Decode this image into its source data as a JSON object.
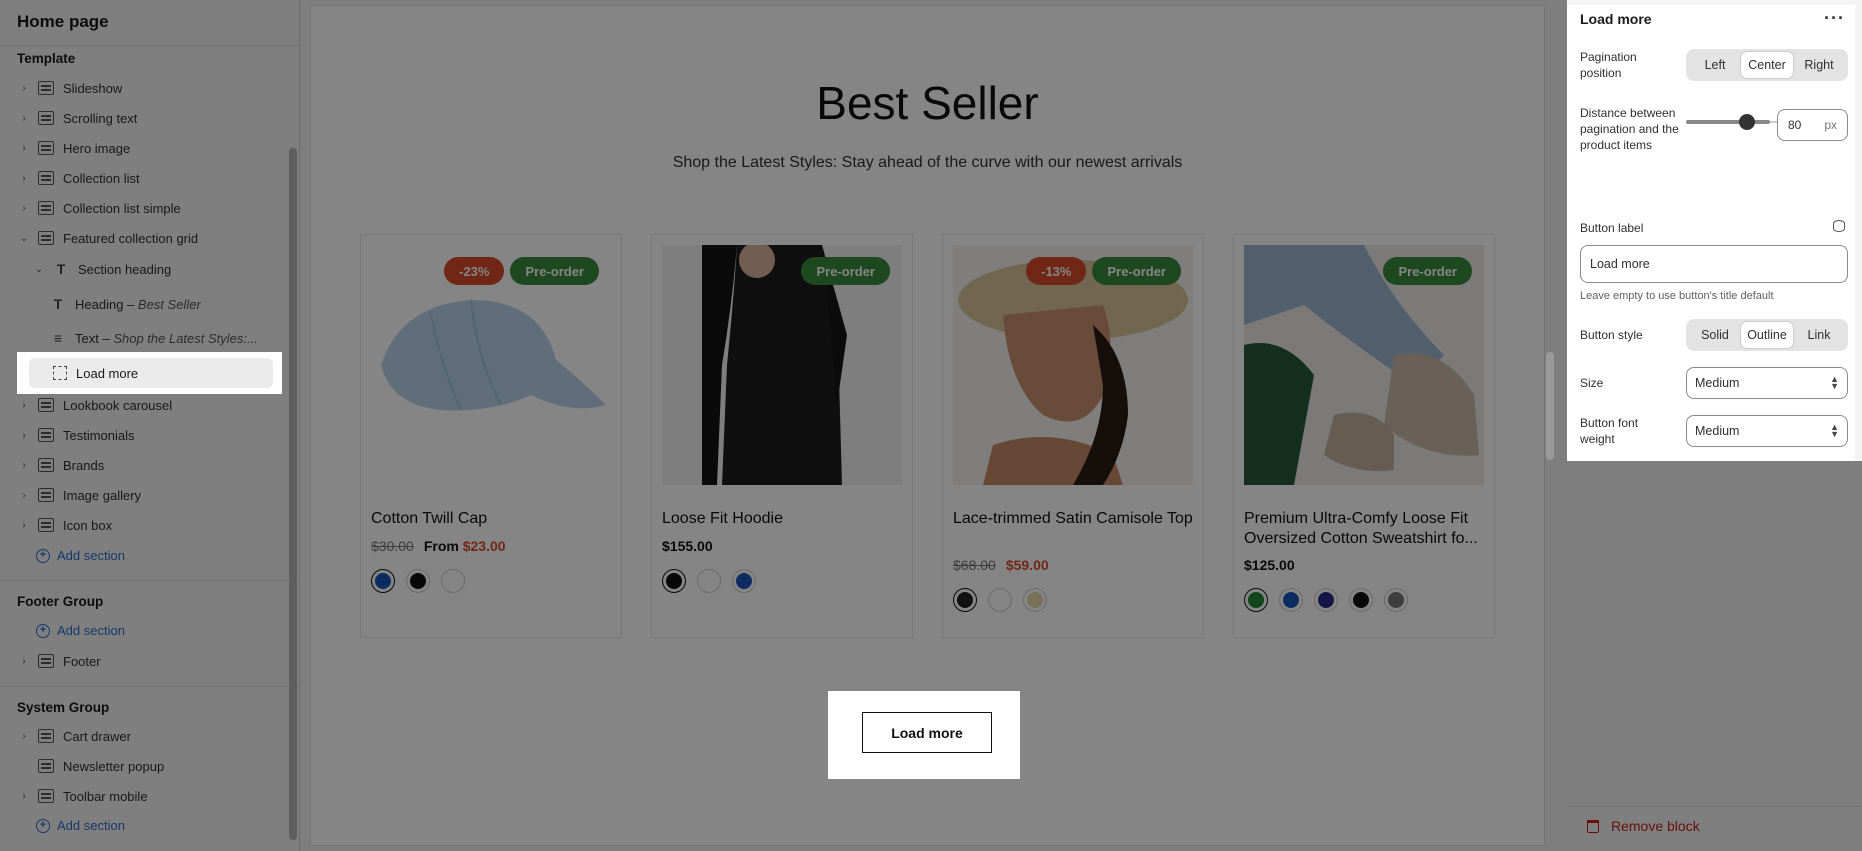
{
  "sidebar": {
    "title": "Home page",
    "template_label": "Template",
    "items": [
      {
        "label": "Slideshow"
      },
      {
        "label": "Scrolling text"
      },
      {
        "label": "Hero image"
      },
      {
        "label": "Collection list"
      },
      {
        "label": "Collection list simple"
      },
      {
        "label": "Featured collection grid"
      },
      {
        "label": "Section heading"
      },
      {
        "label": "Heading",
        "detail": "Best Seller"
      },
      {
        "label": "Text",
        "detail": "Shop the Latest Styles:..."
      },
      {
        "label": "Load more"
      },
      {
        "label": "Lookbook carousel"
      },
      {
        "label": "Testimonials"
      },
      {
        "label": "Brands"
      },
      {
        "label": "Image gallery"
      },
      {
        "label": "Icon box"
      }
    ],
    "add_section": "Add section",
    "footer_group": "Footer Group",
    "footer_item": "Footer",
    "system_group": "System Group",
    "system_items": [
      {
        "label": "Cart drawer"
      },
      {
        "label": "Newsletter popup"
      },
      {
        "label": "Toolbar mobile"
      }
    ]
  },
  "preview": {
    "heading": "Best Seller",
    "subheading": "Shop the Latest Styles: Stay ahead of the curve with our newest arrivals",
    "products": [
      {
        "title": "Cotton Twill Cap",
        "badges": [
          "-23%",
          "Pre-order"
        ],
        "old_price": "$30.00",
        "from_label": "From",
        "price": "$23.00",
        "swatches": [
          "#1a55b8",
          "#111111",
          "#ffffff"
        ]
      },
      {
        "title": "Loose Fit Hoodie",
        "badges": [
          "Pre-order"
        ],
        "price": "$155.00",
        "swatches": [
          "#111111",
          "#ffffff",
          "#1a55b8"
        ]
      },
      {
        "title": "Lace-trimmed Satin Camisole Top",
        "badges": [
          "-13%",
          "Pre-order"
        ],
        "old_price": "$68.00",
        "price": "$59.00",
        "swatches": [
          "#222222",
          "#ffffff",
          "#e8d6a8"
        ]
      },
      {
        "title": "Premium Ultra-Comfy Loose Fit Oversized Cotton Sweatshirt fo...",
        "badges": [
          "Pre-order"
        ],
        "price": "$125.00",
        "swatches": [
          "#1f8a3a",
          "#1a55b8",
          "#2a2a8a",
          "#111111",
          "#777777"
        ]
      }
    ],
    "load_more": "Load more"
  },
  "panel": {
    "title": "Load more",
    "pagination_position_label": "Pagination position",
    "pagination_options": [
      "Left",
      "Center",
      "Right"
    ],
    "pagination_selected": "Center",
    "distance_label": "Distance between pagination and the product items",
    "distance_value": "80",
    "distance_unit": "px",
    "button_label_label": "Button label",
    "button_label_value": "Load more",
    "button_label_hint": "Leave empty to use button's title default",
    "button_style_label": "Button style",
    "button_style_options": [
      "Solid",
      "Outline",
      "Link"
    ],
    "button_style_selected": "Outline",
    "size_label": "Size",
    "size_value": "Medium",
    "font_weight_label": "Button font weight",
    "font_weight_value": "Medium",
    "remove_label": "Remove block"
  },
  "colors": {
    "accent": "#2c6ecb",
    "sale_badge": "#d94b2b",
    "preorder_badge": "#3a8a3e",
    "danger": "#c4221a"
  }
}
